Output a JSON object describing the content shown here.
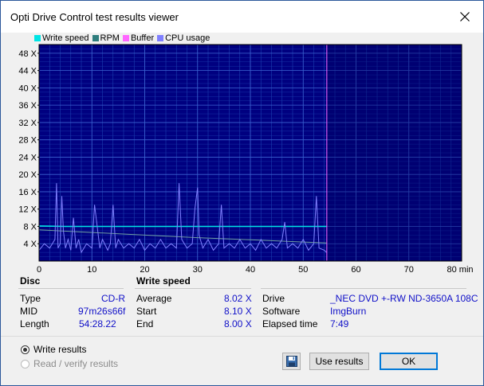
{
  "window": {
    "title": "Opti Drive Control test results viewer"
  },
  "legend": [
    {
      "name": "Write speed",
      "color": "#00e5e5"
    },
    {
      "name": "RPM",
      "color": "#2e7d7d"
    },
    {
      "name": "Buffer",
      "color": "#ff66ff"
    },
    {
      "name": "CPU usage",
      "color": "#8080ff"
    }
  ],
  "chart_data": {
    "type": "line",
    "xlabel": "min",
    "xlim": [
      0,
      80
    ],
    "ylim": [
      0,
      50
    ],
    "x_ticks": [
      "0",
      "10",
      "20",
      "30",
      "40",
      "50",
      "60",
      "70",
      "80 min"
    ],
    "y_ticks": [
      "4 X",
      "8 X",
      "12 X",
      "16 X",
      "20 X",
      "24 X",
      "28 X",
      "32 X",
      "36 X",
      "40 X",
      "44 X",
      "48 X"
    ],
    "y_tick_values": [
      4,
      8,
      12,
      16,
      20,
      24,
      28,
      32,
      36,
      40,
      44,
      48
    ],
    "x_tick_values": [
      0,
      10,
      20,
      30,
      40,
      50,
      60,
      70,
      80
    ],
    "end_marker_x": 54.47,
    "grid": true,
    "background": "#000080",
    "series": [
      {
        "name": "Write speed",
        "color": "#00e5e5",
        "x": [
          0,
          5,
          10,
          15,
          20,
          25,
          30,
          35,
          40,
          45,
          50,
          54.4
        ],
        "values": [
          8.1,
          8.0,
          8.0,
          8.0,
          8.0,
          8.0,
          8.0,
          8.0,
          8.0,
          8.0,
          8.0,
          8.0
        ]
      },
      {
        "name": "RPM",
        "color": "#6fa0a0",
        "x": [
          0,
          10,
          20,
          30,
          40,
          50,
          54.4
        ],
        "values": [
          7.2,
          6.6,
          6.0,
          5.4,
          4.9,
          4.4,
          4.2
        ]
      },
      {
        "name": "Buffer",
        "color": "#ff66ff",
        "x": [
          0,
          54.4
        ],
        "values": [
          50,
          50
        ]
      },
      {
        "name": "CPU usage",
        "color": "#8080ff",
        "x": [
          0,
          1,
          2,
          3,
          3.3,
          3.6,
          4,
          4.3,
          4.6,
          5,
          5.5,
          6,
          6.5,
          7,
          7.5,
          8,
          9,
          10,
          10.5,
          11,
          11.5,
          12,
          13,
          13.5,
          14,
          14.5,
          15,
          16,
          17,
          18,
          19,
          20,
          21,
          22,
          23,
          24,
          25,
          26,
          26.5,
          27,
          28,
          29,
          29.5,
          30,
          30.3,
          31,
          32,
          33,
          34,
          34.5,
          35,
          36,
          37,
          38,
          39,
          40,
          41,
          42,
          43,
          44,
          45,
          46,
          46.5,
          47,
          48,
          49,
          50,
          51,
          52,
          52.5,
          53,
          54,
          54.4
        ],
        "values": [
          2.5,
          4,
          3,
          5,
          18,
          3,
          4,
          15,
          7,
          3,
          5,
          2.5,
          10,
          3,
          5,
          2,
          4,
          3,
          13,
          8,
          3,
          5,
          2.5,
          4,
          13,
          3,
          5,
          3,
          4,
          3,
          5,
          2.5,
          4,
          3,
          5,
          3,
          4,
          3,
          18,
          5,
          3,
          4,
          12,
          17,
          6,
          3,
          5,
          2.5,
          4,
          13,
          3,
          4,
          3,
          5,
          3,
          4,
          2.5,
          5,
          3,
          4,
          3,
          5,
          9,
          3,
          4,
          3,
          5,
          2.5,
          4,
          15,
          3,
          2.5,
          2
        ]
      }
    ]
  },
  "disc": {
    "header": "Disc",
    "rows": [
      {
        "label": "Type",
        "value": "CD-R"
      },
      {
        "label": "MID",
        "value": "97m26s66f"
      },
      {
        "label": "Length",
        "value": "54:28.22"
      }
    ]
  },
  "write_speed": {
    "header": "Write speed",
    "rows": [
      {
        "label": "Average",
        "value": "8.02 X"
      },
      {
        "label": "Start",
        "value": "8.10 X"
      },
      {
        "label": "End",
        "value": "8.00 X"
      }
    ]
  },
  "drive_info": {
    "rows": [
      {
        "label": "Drive",
        "value": "_NEC DVD +-RW ND-3650A 108C"
      },
      {
        "label": "Software",
        "value": "ImgBurn"
      },
      {
        "label": "Elapsed time",
        "value": "7:49"
      }
    ]
  },
  "options": {
    "write_results": "Write results",
    "read_verify_results": "Read / verify results"
  },
  "buttons": {
    "use_results": "Use results",
    "ok": "OK"
  }
}
